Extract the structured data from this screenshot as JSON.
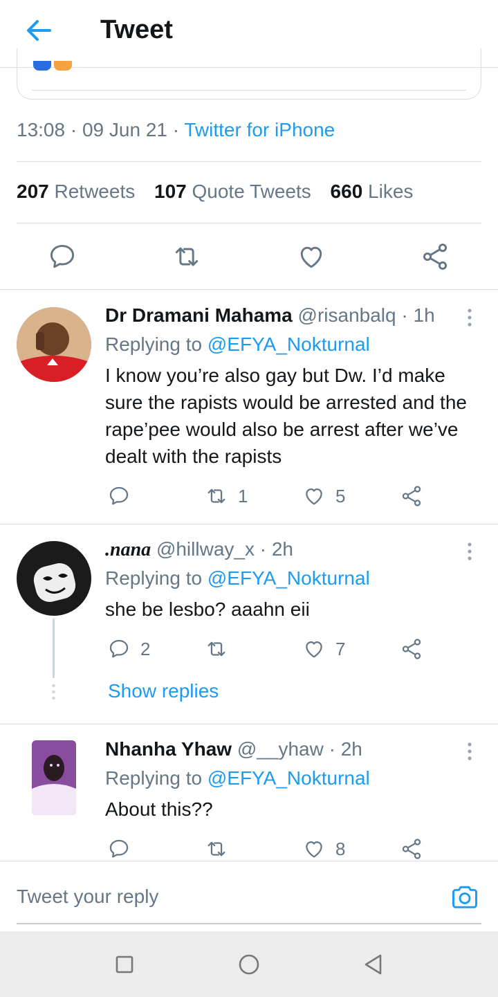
{
  "header": {
    "title": "Tweet"
  },
  "tweet": {
    "time": "13:08",
    "date": "09 Jun 21",
    "source": "Twitter for iPhone",
    "stats": {
      "retweets_count": "207",
      "retweets_label": "Retweets",
      "quotes_count": "107",
      "quotes_label": "Quote Tweets",
      "likes_count": "660",
      "likes_label": "Likes"
    }
  },
  "replies": [
    {
      "name": "Dr Dramani Mahama",
      "handle": "@risanbalq",
      "time": "1h",
      "replying_prefix": "Replying to",
      "replying_to": "@EFYA_Nokturnal",
      "text": "I know you’re also gay but Dw. I’d make sure the rapists would be arrested and the rape’pee would also be arrest after we’ve dealt with the rapists",
      "reply_count": "",
      "retweet_count": "1",
      "like_count": "5"
    },
    {
      "name": ".nana",
      "handle": "@hillway_x",
      "time": "2h",
      "replying_prefix": "Replying to",
      "replying_to": "@EFYA_Nokturnal",
      "text": "she be lesbo? aaahn eii",
      "reply_count": "2",
      "retweet_count": "",
      "like_count": "7",
      "show_replies": "Show replies"
    },
    {
      "name": "Nhanha Yhaw",
      "handle": "@__yhaw",
      "time": "2h",
      "replying_prefix": "Replying to",
      "replying_to": "@EFYA_Nokturnal",
      "text": "About this??",
      "reply_count": "",
      "retweet_count": "",
      "like_count": "8"
    }
  ],
  "reply_bar": {
    "placeholder": "Tweet your reply"
  },
  "colors": {
    "accent": "#1d9bf0",
    "muted": "#657786",
    "text": "#14171a",
    "divider": "#dadde1"
  },
  "icons": [
    "back-arrow-icon",
    "reply-icon",
    "retweet-icon",
    "like-icon",
    "share-icon",
    "more-vertical-icon",
    "camera-icon",
    "nav-recents-icon",
    "nav-home-icon",
    "nav-back-icon"
  ]
}
